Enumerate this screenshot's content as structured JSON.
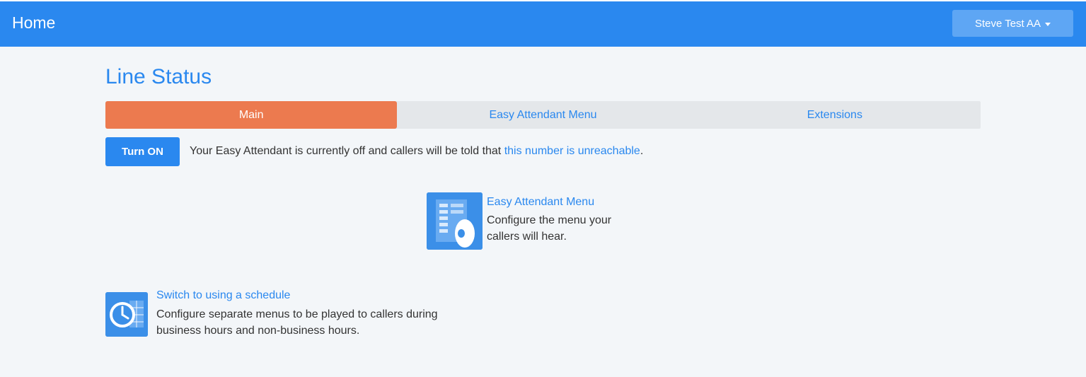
{
  "navbar": {
    "brand": "Home",
    "user_menu": "Steve Test AA",
    "user_menu_icon": "caret-down-icon"
  },
  "page": {
    "title": "Line Status"
  },
  "tabs": [
    {
      "label": "Main",
      "active": true
    },
    {
      "label": "Easy Attendant Menu",
      "active": false
    },
    {
      "label": "Extensions",
      "active": false
    }
  ],
  "status": {
    "button_label": "Turn ON",
    "message": "Your Easy Attendant is currently off and callers will be told that ",
    "link_text": "this number is unreachable",
    "suffix": "."
  },
  "features": {
    "menu": {
      "icon": "menu-speaker-icon",
      "title": "Easy Attendant Menu",
      "description_line1": "Configure the menu your",
      "description_line2": "callers will hear."
    },
    "schedule": {
      "icon": "clock-calendar-icon",
      "title": "Switch to using a schedule",
      "description_line1": "Configure separate menus to be played to callers during",
      "description_line2": "business hours and non-business hours."
    }
  },
  "colors": {
    "primary": "#2a88ef",
    "active_tab": "#ec7a4f",
    "tab_bar": "#e4e7ea",
    "background": "#f3f6f9"
  }
}
